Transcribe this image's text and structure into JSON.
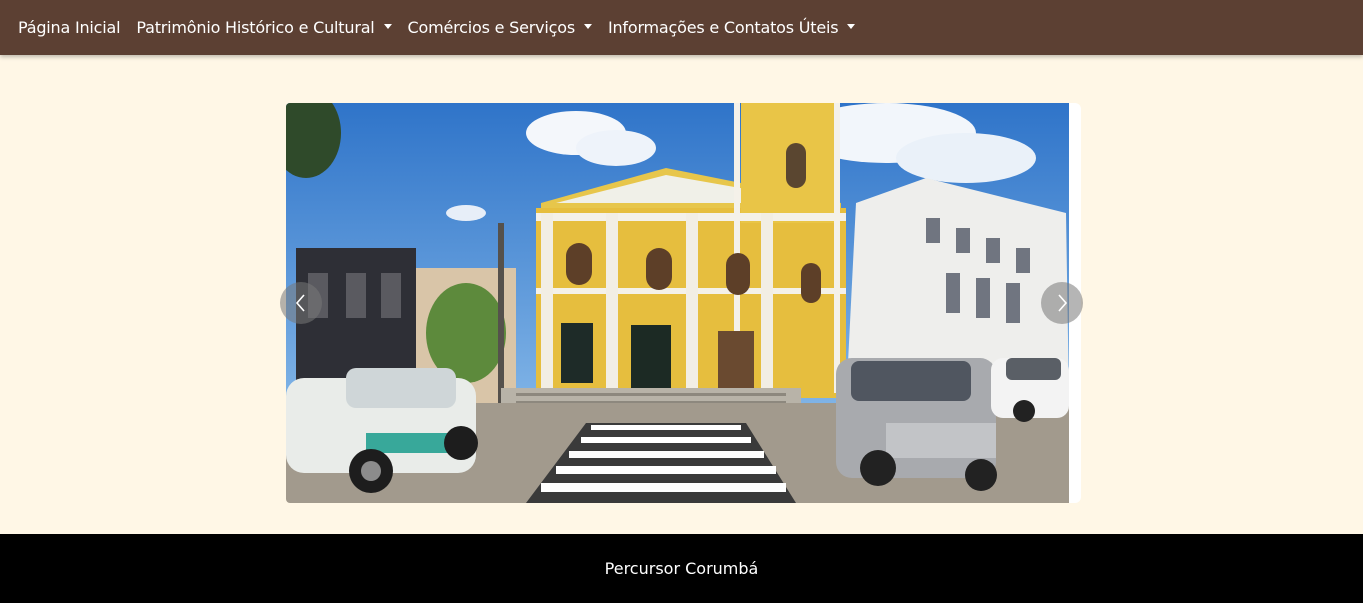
{
  "navbar": {
    "items": [
      {
        "label": "Página Inicial",
        "dropdown": false
      },
      {
        "label": "Patrimônio Histórico e Cultural",
        "dropdown": true
      },
      {
        "label": "Comércios e Serviços",
        "dropdown": true
      },
      {
        "label": "Informações e Contatos Úteis",
        "dropdown": true
      }
    ]
  },
  "carousel": {
    "slide_image": "church-square-photo",
    "prev_icon": "chevron-left-icon",
    "next_icon": "chevron-right-icon"
  },
  "footer": {
    "text": "Percursor Corumbá"
  },
  "colors": {
    "navbar": "#5c4033",
    "background": "#fff7e6",
    "footer": "#000000"
  }
}
